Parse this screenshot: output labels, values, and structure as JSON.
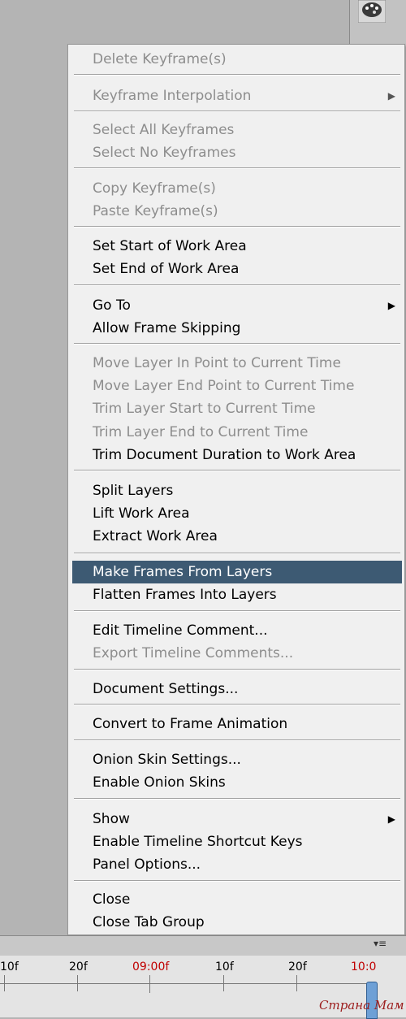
{
  "menu": {
    "items": [
      {
        "label": "Delete Keyframe(s)",
        "enabled": false
      },
      {
        "label": "Keyframe Interpolation",
        "enabled": false,
        "submenu": true
      },
      {
        "label": "Select All Keyframes",
        "enabled": false
      },
      {
        "label": "Select No Keyframes",
        "enabled": false
      },
      {
        "label": "Copy Keyframe(s)",
        "enabled": false
      },
      {
        "label": "Paste Keyframe(s)",
        "enabled": false
      },
      {
        "label": "Set Start of Work Area",
        "enabled": true
      },
      {
        "label": "Set End of Work Area",
        "enabled": true
      },
      {
        "label": "Go To",
        "enabled": true,
        "submenu": true
      },
      {
        "label": "Allow Frame Skipping",
        "enabled": true
      },
      {
        "label": "Move Layer In Point to Current Time",
        "enabled": false
      },
      {
        "label": "Move Layer End Point to Current Time",
        "enabled": false
      },
      {
        "label": "Trim Layer Start to Current Time",
        "enabled": false
      },
      {
        "label": "Trim Layer End to Current Time",
        "enabled": false
      },
      {
        "label": "Trim Document Duration to Work Area",
        "enabled": true
      },
      {
        "label": "Split Layers",
        "enabled": true
      },
      {
        "label": "Lift Work Area",
        "enabled": true
      },
      {
        "label": "Extract Work Area",
        "enabled": true
      },
      {
        "label": "Make Frames From Layers",
        "enabled": true,
        "highlighted": true
      },
      {
        "label": "Flatten Frames Into Layers",
        "enabled": true
      },
      {
        "label": "Edit Timeline Comment...",
        "enabled": true
      },
      {
        "label": "Export Timeline Comments...",
        "enabled": false
      },
      {
        "label": "Document Settings...",
        "enabled": true
      },
      {
        "label": "Convert to Frame Animation",
        "enabled": true
      },
      {
        "label": "Onion Skin Settings...",
        "enabled": true
      },
      {
        "label": "Enable Onion Skins",
        "enabled": true
      },
      {
        "label": "Show",
        "enabled": true,
        "submenu": true
      },
      {
        "label": "Enable Timeline Shortcut Keys",
        "enabled": true
      },
      {
        "label": "Panel Options...",
        "enabled": true
      },
      {
        "label": "Close",
        "enabled": true
      },
      {
        "label": "Close Tab Group",
        "enabled": true
      }
    ],
    "submenu_arrow": "▶"
  },
  "timeline": {
    "ticks": [
      "10f",
      "20f",
      "09:00f",
      "10f",
      "20f",
      "10:0"
    ],
    "current_time_label": "09:00f",
    "panel_menu_icon": "▾≡"
  },
  "watermark": "Страна Мам",
  "colors": {
    "highlight": "#3d5a73",
    "disabled_text": "#8d8d8d",
    "time_red": "#c00000"
  }
}
